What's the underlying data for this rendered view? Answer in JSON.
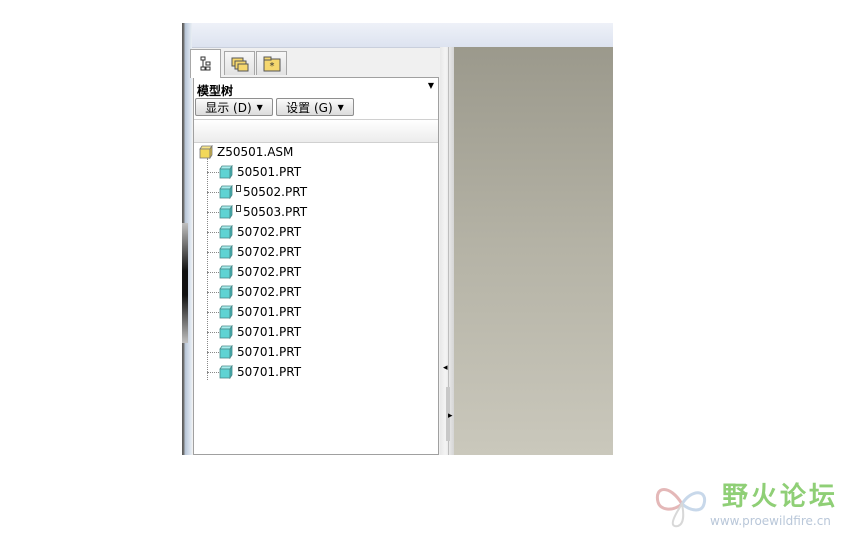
{
  "window": {
    "tabs": [
      {
        "icon": "model-tree-icon",
        "active": true
      },
      {
        "icon": "folder-browser-icon",
        "active": false
      },
      {
        "icon": "favorites-icon",
        "active": false
      }
    ]
  },
  "model_tree": {
    "title": "模型树",
    "show_button": "显示 (D)",
    "settings_button": "设置 (G)",
    "root": {
      "label": "Z50501.ASM",
      "icon": "assembly-icon"
    },
    "items": [
      {
        "label": "50501.PRT",
        "icon": "part-icon",
        "marked": false
      },
      {
        "label": "50502.PRT",
        "icon": "part-icon",
        "marked": true
      },
      {
        "label": "50503.PRT",
        "icon": "part-icon",
        "marked": true
      },
      {
        "label": "50702.PRT",
        "icon": "part-icon",
        "marked": false
      },
      {
        "label": "50702.PRT",
        "icon": "part-icon",
        "marked": false
      },
      {
        "label": "50702.PRT",
        "icon": "part-icon",
        "marked": false
      },
      {
        "label": "50702.PRT",
        "icon": "part-icon",
        "marked": false
      },
      {
        "label": "50701.PRT",
        "icon": "part-icon",
        "marked": false
      },
      {
        "label": "50701.PRT",
        "icon": "part-icon",
        "marked": false
      },
      {
        "label": "50701.PRT",
        "icon": "part-icon",
        "marked": false
      },
      {
        "label": "50701.PRT",
        "icon": "part-icon",
        "marked": false
      }
    ]
  },
  "watermark": {
    "name": "野火论坛",
    "url": "www.proewildfire.cn"
  },
  "colors": {
    "part_fill": "#5fd3d3",
    "assembly_fill": "#f2d85a",
    "viewport_top": "#9b998c",
    "viewport_bottom": "#cac8bc",
    "watermark_green": "#8fcf76"
  }
}
